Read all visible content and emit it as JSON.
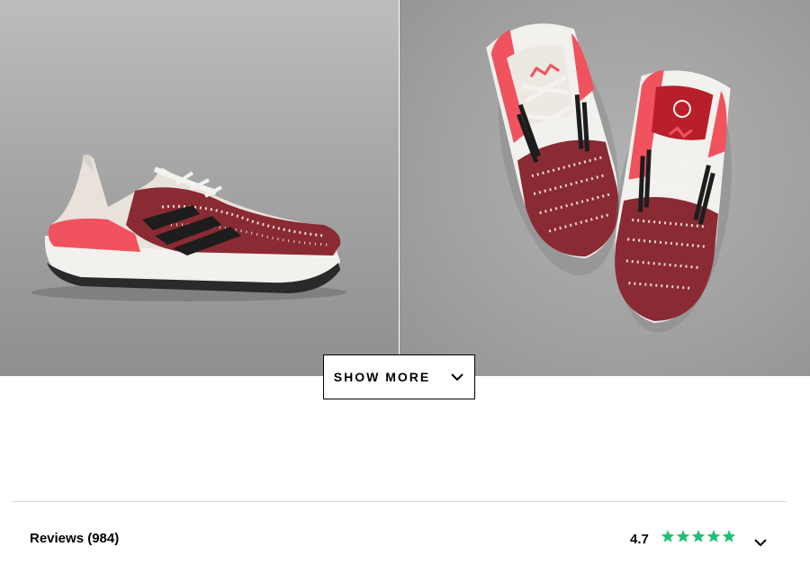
{
  "gallery": {
    "images": [
      {
        "alt": "side-view-shoe"
      },
      {
        "alt": "top-view-pair"
      }
    ],
    "show_more_label": "SHOW MORE"
  },
  "reviews": {
    "label": "Reviews (984)",
    "rating": "4.7",
    "stars": 5,
    "star_color": "#1ec17a"
  },
  "colors": {
    "accent_red": "#f0525e",
    "knit_maroon": "#8a2a33",
    "stripe_black": "#1d1d1d"
  }
}
